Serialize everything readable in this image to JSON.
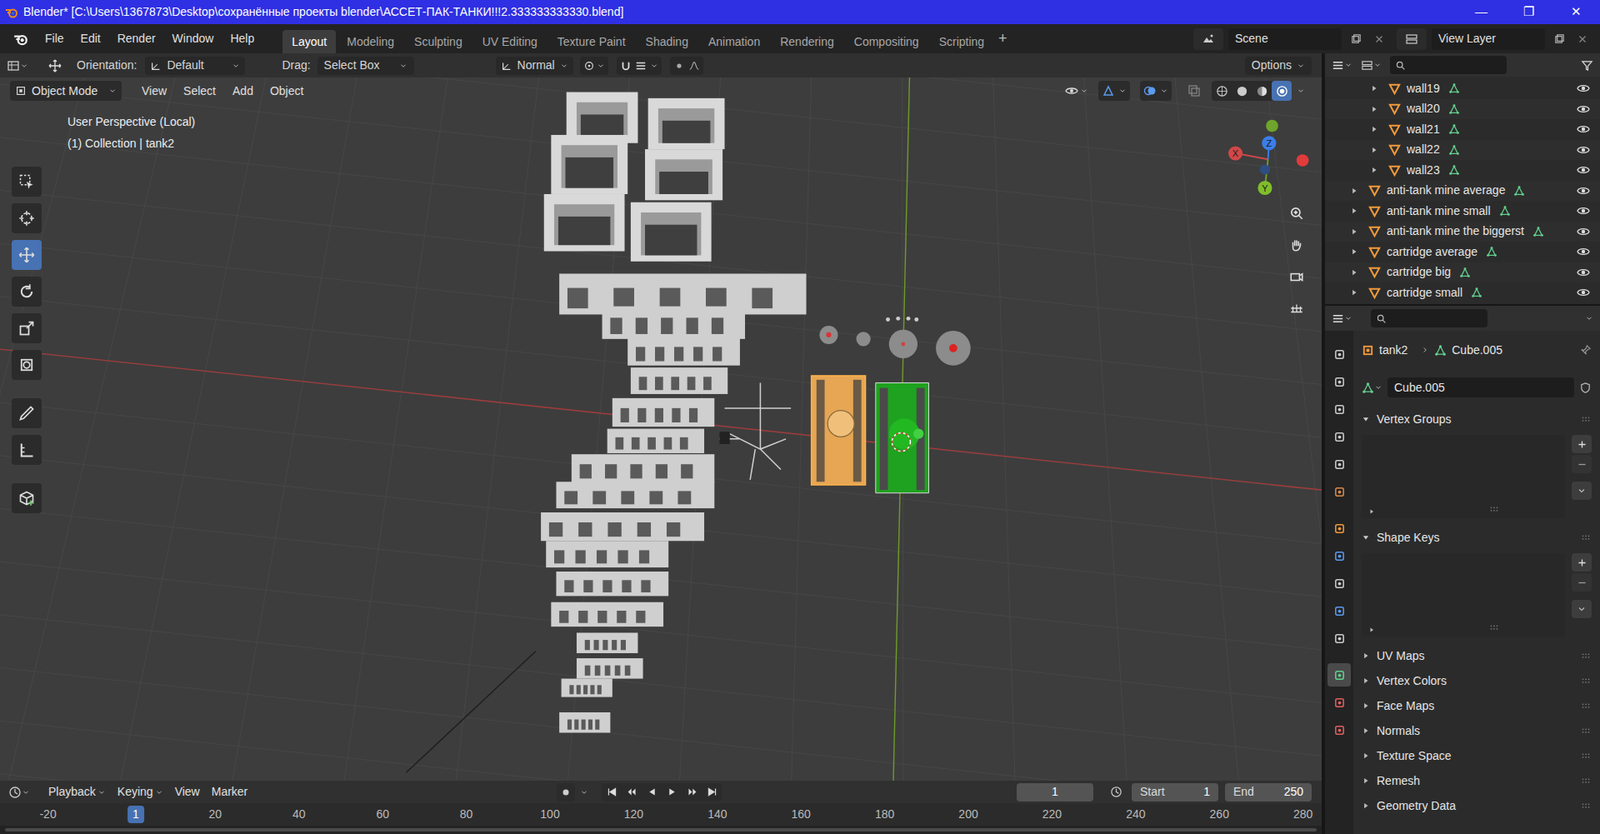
{
  "window": {
    "title": "Blender* [C:\\Users\\1367873\\Desktop\\сохранённые проекты blender\\АССЕТ-ПАК-ТАНКИ!!!2.333333333330.blend]",
    "controls": [
      "—",
      "❐",
      "✕"
    ]
  },
  "menu": [
    "File",
    "Edit",
    "Render",
    "Window",
    "Help"
  ],
  "workspaces": [
    {
      "label": "Layout",
      "selected": true
    },
    {
      "label": "Modeling",
      "selected": false
    },
    {
      "label": "Sculpting",
      "selected": false
    },
    {
      "label": "UV Editing",
      "selected": false
    },
    {
      "label": "Texture Paint",
      "selected": false
    },
    {
      "label": "Shading",
      "selected": false
    },
    {
      "label": "Animation",
      "selected": false
    },
    {
      "label": "Rendering",
      "selected": false
    },
    {
      "label": "Compositing",
      "selected": false
    },
    {
      "label": "Scripting",
      "selected": false
    }
  ],
  "workspace_add": "+",
  "scene": "Scene",
  "view_layer": "View Layer",
  "tool_header": {
    "orientation_label": "Orientation:",
    "orientation": "Default",
    "drag_label": "Drag:",
    "drag": "Select Box",
    "snap": "Normal",
    "options": "Options"
  },
  "viewport": {
    "mode": "Object Mode",
    "menus": [
      "View",
      "Select",
      "Add",
      "Object"
    ],
    "info": [
      "User Perspective (Local)",
      "(1) Collection | tank2"
    ],
    "tools": [
      {
        "selected": false
      },
      {
        "selected": false
      },
      {
        "selected": true
      },
      {
        "selected": false
      },
      {
        "selected": false
      },
      {
        "selected": false
      },
      {
        "selected": false
      },
      {
        "selected": false
      },
      {
        "selected": false
      }
    ],
    "gizmo_axes": [
      "X",
      "Y",
      "Z"
    ],
    "shading": [
      {
        "selected": false
      },
      {
        "selected": false
      },
      {
        "selected": false
      },
      {
        "selected": true
      }
    ]
  },
  "outliner": {
    "items": [
      {
        "label": "wall19",
        "nested": true,
        "visible": true
      },
      {
        "label": "wall20",
        "nested": true,
        "visible": true
      },
      {
        "label": "wall21",
        "nested": true,
        "visible": true
      },
      {
        "label": "wall22",
        "nested": true,
        "visible": true
      },
      {
        "label": "wall23",
        "nested": true,
        "visible": true
      },
      {
        "label": "anti-tank mine average",
        "nested": false,
        "visible": true
      },
      {
        "label": "anti-tank mine small",
        "nested": false,
        "visible": true
      },
      {
        "label": "anti-tank mine the biggerst",
        "nested": false,
        "visible": true
      },
      {
        "label": "cartridge average",
        "nested": false,
        "visible": true
      },
      {
        "label": "cartridge big",
        "nested": false,
        "visible": true
      },
      {
        "label": "cartridge small",
        "nested": false,
        "visible": true
      }
    ]
  },
  "properties": {
    "tabs": [
      {
        "selected": false
      },
      {
        "selected": false
      },
      {
        "selected": false
      },
      {
        "selected": false
      },
      {
        "selected": false
      },
      {
        "selected": false
      },
      {
        "selected": false
      },
      {
        "selected": false
      },
      {
        "selected": false
      },
      {
        "selected": false
      },
      {
        "selected": false
      },
      {
        "selected": true
      },
      {
        "selected": false
      },
      {
        "selected": false
      }
    ],
    "object": "tank2",
    "data": "Cube.005",
    "mesh_field": "Cube.005",
    "panels": [
      {
        "label": "Vertex Groups",
        "expanded": true
      },
      {
        "label": "Shape Keys",
        "expanded": true
      },
      {
        "label": "UV Maps",
        "expanded": false
      },
      {
        "label": "Vertex Colors",
        "expanded": false
      },
      {
        "label": "Face Maps",
        "expanded": false
      },
      {
        "label": "Normals",
        "expanded": false
      },
      {
        "label": "Texture Space",
        "expanded": false
      },
      {
        "label": "Remesh",
        "expanded": false
      },
      {
        "label": "Geometry Data",
        "expanded": false
      }
    ]
  },
  "timeline": {
    "menus": [
      "Playback",
      "Keying",
      "View",
      "Marker"
    ],
    "frame": "1",
    "start_label": "Start",
    "start": "1",
    "end_label": "End",
    "end": "250",
    "ruler": [
      {
        "label": "-20",
        "selected": false
      },
      {
        "label": "1",
        "selected": true
      },
      {
        "label": "20",
        "selected": false
      },
      {
        "label": "40",
        "selected": false
      },
      {
        "label": "60",
        "selected": false
      },
      {
        "label": "80",
        "selected": false
      },
      {
        "label": "100",
        "selected": false
      },
      {
        "label": "120",
        "selected": false
      },
      {
        "label": "140",
        "selected": false
      },
      {
        "label": "160",
        "selected": false
      },
      {
        "label": "180",
        "selected": false
      },
      {
        "label": "200",
        "selected": false
      },
      {
        "label": "220",
        "selected": false
      },
      {
        "label": "240",
        "selected": false
      },
      {
        "label": "260",
        "selected": false
      },
      {
        "label": "280",
        "selected": false
      }
    ]
  }
}
